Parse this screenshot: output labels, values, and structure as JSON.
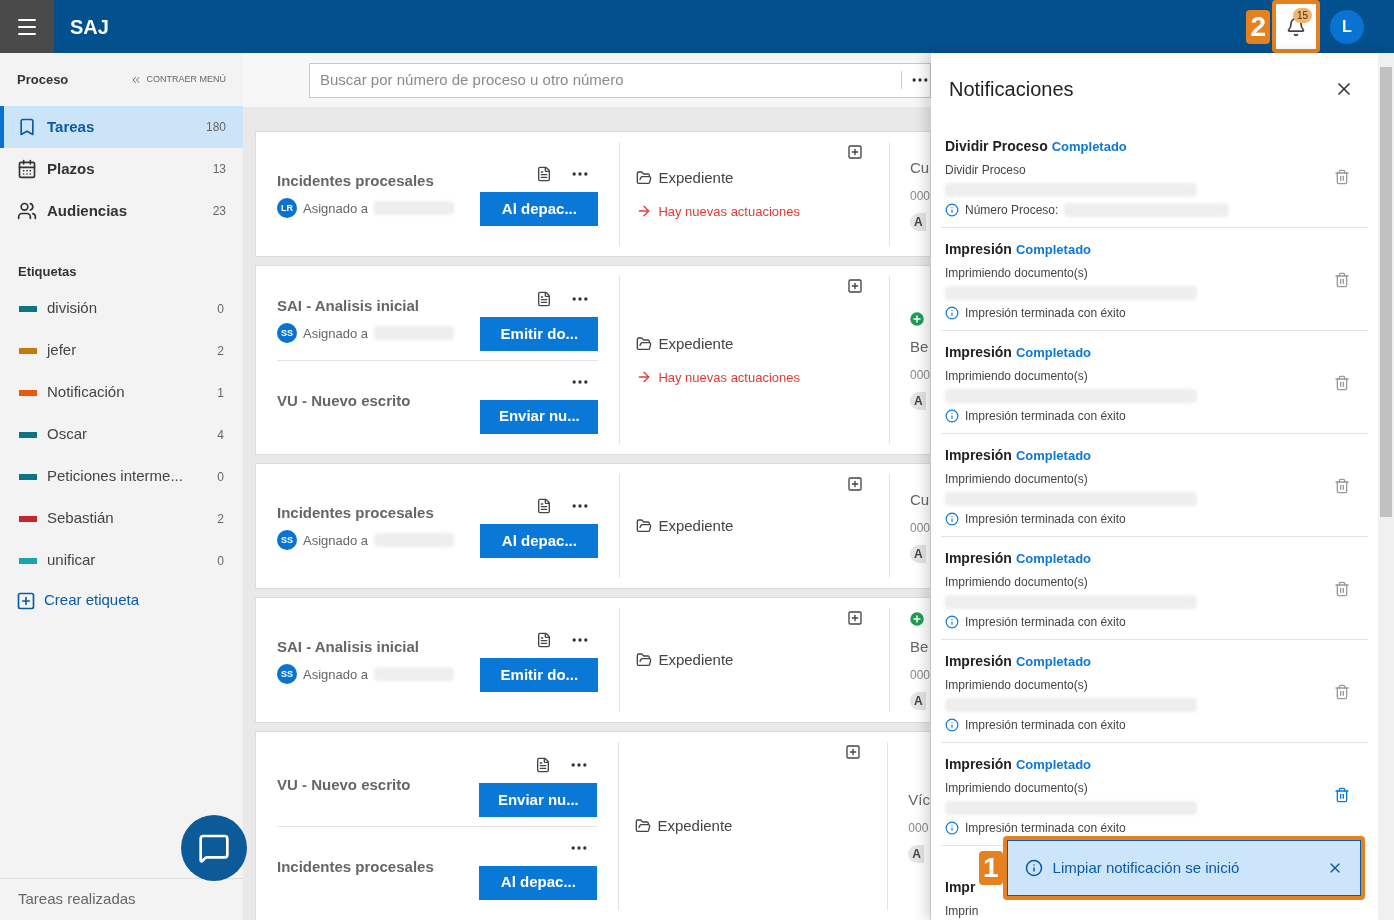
{
  "header": {
    "app_name": "SAJ",
    "notification_count": "15",
    "bell_callout": "2",
    "user_initial": "L"
  },
  "sidebar": {
    "section_title": "Proceso",
    "collapse_label": "CONTRAER MENÚ",
    "nav": [
      {
        "kind": "tasks",
        "label": "Tareas",
        "count": "180",
        "selected": true
      },
      {
        "kind": "calendar",
        "label": "Plazos",
        "count": "13",
        "selected": false
      },
      {
        "kind": "people",
        "label": "Audiencias",
        "count": "23",
        "selected": false
      }
    ],
    "tags_title": "Etiquetas",
    "tags": [
      {
        "label": "división",
        "count": "0",
        "color": "#0f7382"
      },
      {
        "label": "jefer",
        "count": "2",
        "color": "#c27c0e"
      },
      {
        "label": "Notificación",
        "count": "1",
        "color": "#e8590c"
      },
      {
        "label": "Oscar",
        "count": "4",
        "color": "#0f7382"
      },
      {
        "label": "Peticiones interme...",
        "count": "0",
        "color": "#0f7382"
      },
      {
        "label": "Sebastián",
        "count": "2",
        "color": "#c4262e"
      },
      {
        "label": "unificar",
        "count": "0",
        "color": "#1ba1b0"
      }
    ],
    "create_tag": "Crear etiqueta",
    "footer": "Tareas realizadas"
  },
  "search": {
    "placeholder": "Buscar por número de proceso u otro número"
  },
  "cards": [
    {
      "tasks": [
        {
          "title": "Incidentes procesales",
          "avatar": "LR",
          "assigned_label": "Asignado a",
          "action": "Al depac..."
        }
      ],
      "file_label": "Expediente",
      "new_activity": "Hay nuevas actuaciones",
      "column_3": {
        "added": false,
        "title": "Cu",
        "number": "000",
        "chip": "A"
      }
    },
    {
      "tasks": [
        {
          "title": "SAI - Analisis inicial",
          "avatar": "SS",
          "assigned_label": "Asignado a",
          "action": "Emitir do..."
        },
        {
          "title": "VU - Nuevo escrito",
          "action": "Enviar nu..."
        }
      ],
      "file_label": "Expediente",
      "new_activity": "Hay nuevas actuaciones",
      "column_3": {
        "added": true,
        "title": "Be",
        "number": "000",
        "chip": "A"
      }
    },
    {
      "tasks": [
        {
          "title": "Incidentes procesales",
          "avatar": "SS",
          "assigned_label": "Asignado a",
          "action": "Al depac..."
        }
      ],
      "file_label": "Expediente",
      "column_3": {
        "added": false,
        "title": "Cu",
        "number": "000",
        "chip": "A"
      }
    },
    {
      "tasks": [
        {
          "title": "SAI - Analisis inicial",
          "avatar": "SS",
          "assigned_label": "Asignado a",
          "action": "Emitir do..."
        }
      ],
      "file_label": "Expediente",
      "column_3": {
        "added": true,
        "title": "Be",
        "number": "000",
        "chip": "A"
      }
    },
    {
      "tasks": [
        {
          "title": "VU - Nuevo escrito",
          "action": "Enviar nu..."
        },
        {
          "title": "Incidentes procesales",
          "action": "Al depac..."
        }
      ],
      "file_label": "Expediente",
      "column_3": {
        "added": false,
        "title": "Víc",
        "number": "000",
        "chip": "A"
      }
    }
  ],
  "notifications": {
    "title": "Notificaciones",
    "items": [
      {
        "title": "Dividir Proceso",
        "status": "Completado",
        "subtitle": "Dividir Proceso",
        "detail": "Número Proceso:",
        "hovered": false
      },
      {
        "title": "Impresión",
        "status": "Completado",
        "subtitle": "Imprimiendo documento(s)",
        "detail": "Impresión terminada con éxito",
        "hovered": false
      },
      {
        "title": "Impresión",
        "status": "Completado",
        "subtitle": "Imprimiendo documento(s)",
        "detail": "Impresión terminada con éxito",
        "hovered": false
      },
      {
        "title": "Impresión",
        "status": "Completado",
        "subtitle": "Imprimiendo documento(s)",
        "detail": "Impresión terminada con éxito",
        "hovered": false
      },
      {
        "title": "Impresión",
        "status": "Completado",
        "subtitle": "Imprimiendo documento(s)",
        "detail": "Impresión terminada con éxito",
        "hovered": false
      },
      {
        "title": "Impresión",
        "status": "Completado",
        "subtitle": "Imprimiendo documento(s)",
        "detail": "Impresión terminada con éxito",
        "hovered": false
      },
      {
        "title": "Impresión",
        "status": "Completado",
        "subtitle": "Imprimiendo documento(s)",
        "detail": "Impresión terminada con éxito",
        "hovered": true
      },
      {
        "title": "Impr",
        "subtitle": "Imprin"
      }
    ]
  },
  "toast": {
    "message": "Limpiar notificación se inició",
    "callout": "1"
  }
}
